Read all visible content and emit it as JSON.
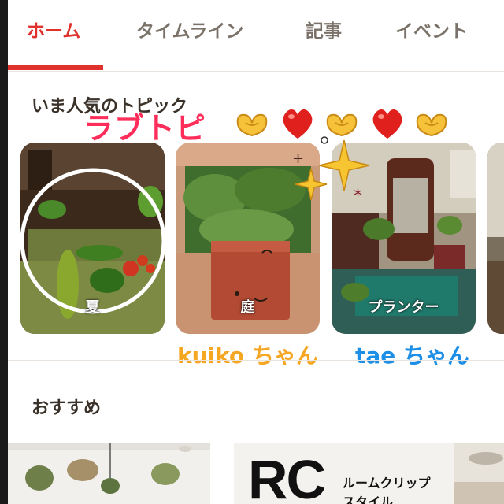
{
  "tabs": [
    {
      "label": "ホーム",
      "active": true
    },
    {
      "label": "タイムライン",
      "active": false
    },
    {
      "label": "記事",
      "active": false
    },
    {
      "label": "イベント",
      "active": false
    }
  ],
  "accent_color": "#e0312d",
  "popular": {
    "title": "いま人気のトピック",
    "overlay_text": "ラブトピ",
    "topics": [
      {
        "label": "夏"
      },
      {
        "label": "庭"
      },
      {
        "label": "プランター"
      }
    ],
    "handles": [
      {
        "text": "kuiko ちゃん",
        "color": "#f5a623"
      },
      {
        "text": "tae ちゃん",
        "color": "#1d8fe6"
      }
    ]
  },
  "recommend": {
    "title": "おすすめ",
    "cards": [
      {
        "logo": "RC",
        "line1": "ルームクリップ",
        "line2": "スタイル"
      }
    ]
  },
  "icons": [
    "heart-hands-icon",
    "red-heart-icon",
    "sparkle-icon"
  ]
}
